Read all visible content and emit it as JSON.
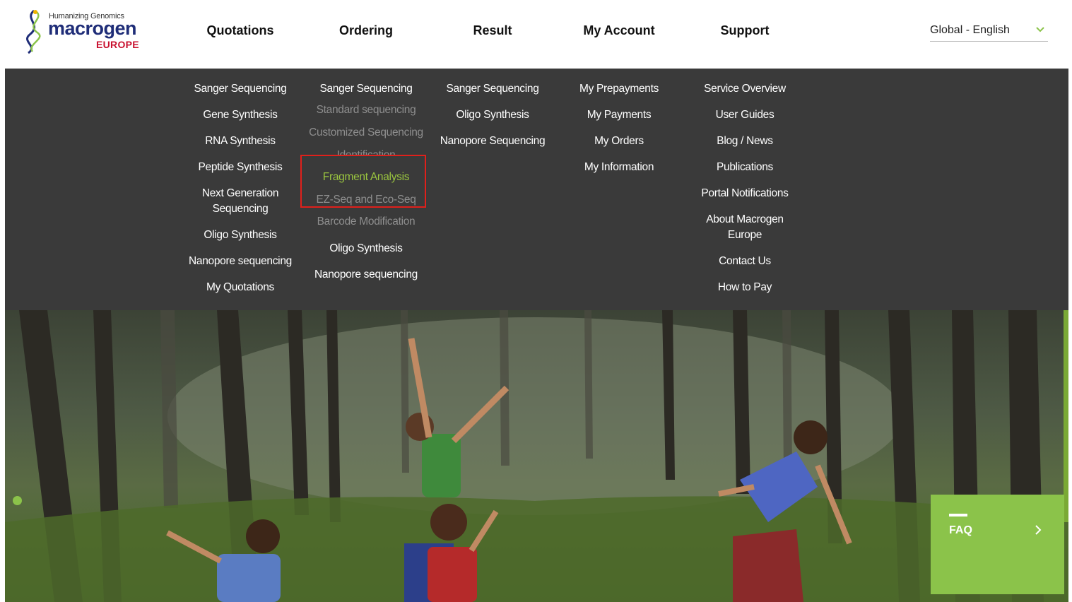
{
  "logo": {
    "tagline": "Humanizing Genomics",
    "wordmark": "macrogen",
    "region": "EUROPE",
    "colors": {
      "wordmark": "#1f2d78",
      "region": "#c8102e"
    }
  },
  "nav": {
    "quotations": "Quotations",
    "ordering": "Ordering",
    "result": "Result",
    "my_account": "My Account",
    "support": "Support"
  },
  "language": {
    "label": "Global - English"
  },
  "menu": {
    "quotations": {
      "items": [
        "Sanger Sequencing",
        "Gene Synthesis",
        "RNA Synthesis",
        "Peptide Synthesis",
        "Next Generation",
        "Sequencing",
        "Oligo Synthesis",
        "Nanopore sequencing",
        "My Quotations"
      ]
    },
    "ordering": {
      "sanger": "Sanger Sequencing",
      "standard": "Standard sequencing",
      "customized": "Customized Sequencing",
      "identification": "Identification",
      "fragment": "Fragment Analysis",
      "ezseq": "EZ-Seq and Eco-Seq",
      "barcode": "Barcode Modification",
      "oligo": "Oligo Synthesis",
      "nanopore": "Nanopore sequencing"
    },
    "result": {
      "items": [
        "Sanger Sequencing",
        "Oligo Synthesis",
        "Nanopore Sequencing"
      ]
    },
    "my_account": {
      "items": [
        "My Prepayments",
        "My Payments",
        "My Orders",
        "My Information"
      ]
    },
    "support": {
      "items": [
        "Service Overview",
        "User Guides",
        "Blog / News",
        "Publications",
        "Portal Notifications",
        "About Macrogen",
        "Europe",
        "Contact Us",
        "How to Pay"
      ]
    }
  },
  "faq": {
    "label": "FAQ"
  },
  "colors": {
    "menu_bg": "#3a3a3a",
    "active": "#9ac53f",
    "accent_green": "#8bc34a",
    "highlight": "#e0201b"
  }
}
